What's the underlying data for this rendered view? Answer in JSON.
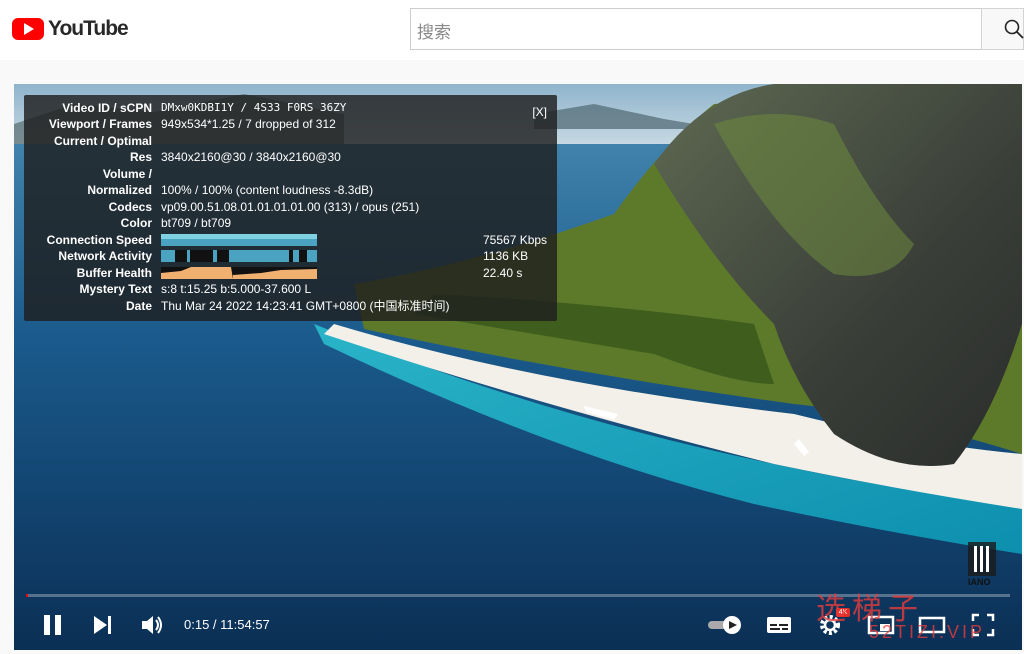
{
  "header": {
    "logo_text": "YouTube",
    "search_placeholder": "搜索"
  },
  "stats": {
    "close_label": "[X]",
    "rows": [
      {
        "label": "Video ID / sCPN",
        "value": "DMxw0KDBI1Y / 4S33 F0RS 36ZY"
      },
      {
        "label": "Viewport / Frames",
        "value": "949x534*1.25 / 7 dropped of 312"
      },
      {
        "label": "Current / Optimal",
        "value": ""
      },
      {
        "label": "Res",
        "value": "3840x2160@30 / 3840x2160@30"
      },
      {
        "label": "Volume /",
        "value": ""
      },
      {
        "label": "Normalized",
        "value": "100% / 100% (content loudness -8.3dB)"
      },
      {
        "label": "Codecs",
        "value": "vp09.00.51.08.01.01.01.01.00 (313) / opus (251)"
      },
      {
        "label": "Color",
        "value": "bt709 / bt709"
      },
      {
        "label": "Connection Speed",
        "value": "75567 Kbps"
      },
      {
        "label": "Network Activity",
        "value": "1136 KB"
      },
      {
        "label": "Buffer Health",
        "value": "22.40 s"
      },
      {
        "label": "Mystery Text",
        "value": "s:8 t:15.25 b:5.000-37.600 L"
      },
      {
        "label": "Date",
        "value": "Thu Mar 24 2022 14:23:41 GMT+0800 (中国标准时间)"
      }
    ]
  },
  "controls": {
    "time": "0:15 / 11:54:57",
    "progress_fraction": 0.0004,
    "settings_badge": "4K"
  },
  "overlay": {
    "channel_logo_text": "IANO",
    "watermark_main": "选梯子",
    "watermark_sub": "52TIZI.VIP"
  },
  "colors": {
    "brand": "#ff0000",
    "speed_bar": "#5fb3c8",
    "buffer_bar": "#f0b070"
  }
}
